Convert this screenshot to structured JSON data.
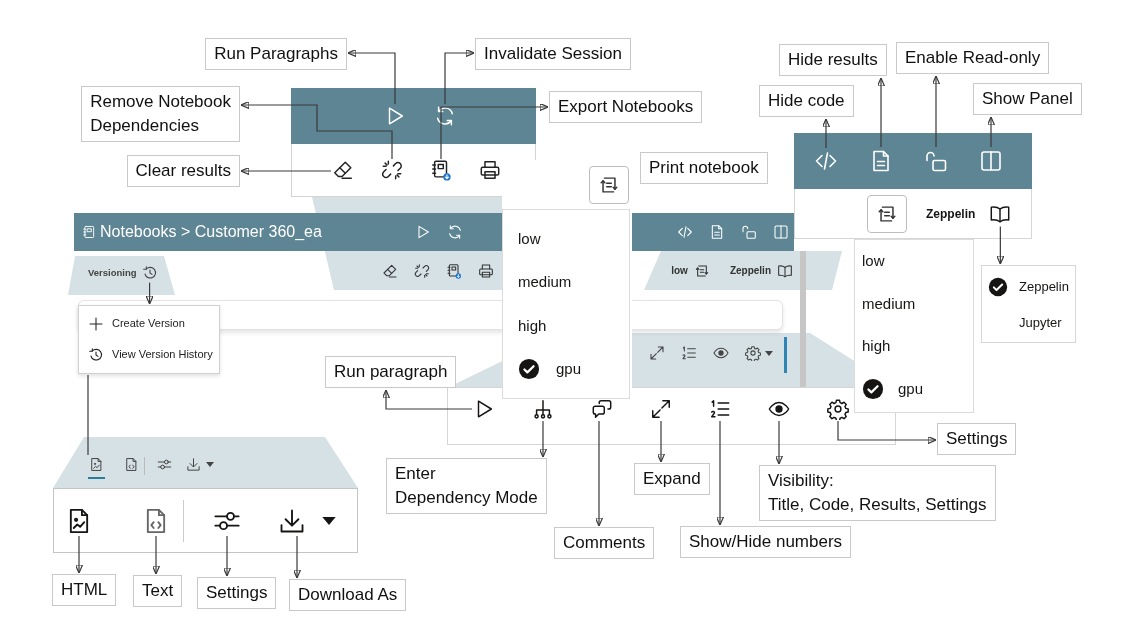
{
  "callouts": [
    {
      "lines": [
        "Run Paragraphs"
      ]
    },
    {
      "lines": [
        "Invalidate Session"
      ]
    },
    {
      "lines": [
        "Remove Notebook",
        "Dependencies"
      ]
    },
    {
      "lines": [
        "Export Notebooks"
      ]
    },
    {
      "lines": [
        "Clear results"
      ]
    },
    {
      "lines": [
        "Print notebook"
      ]
    },
    {
      "lines": [
        "Hide results"
      ]
    },
    {
      "lines": [
        "Enable Read-only"
      ]
    },
    {
      "lines": [
        "Hide code"
      ]
    },
    {
      "lines": [
        "Show Panel"
      ]
    },
    {
      "lines": [
        "Run paragraph"
      ]
    },
    {
      "lines": [
        "Settings"
      ]
    },
    {
      "lines": [
        "Enter",
        "Dependency Mode"
      ]
    },
    {
      "lines": [
        "Expand"
      ]
    },
    {
      "lines": [
        "Visibility:",
        "Title, Code, Results, Settings"
      ]
    },
    {
      "lines": [
        "Comments"
      ]
    },
    {
      "lines": [
        "Show/Hide numbers"
      ]
    },
    {
      "lines": [
        "HTML"
      ]
    },
    {
      "lines": [
        "Text"
      ]
    },
    {
      "lines": [
        "Settings"
      ]
    },
    {
      "lines": [
        "Download As"
      ]
    }
  ],
  "compute_popup": {
    "items": [
      {
        "label": "low",
        "selected": false
      },
      {
        "label": "medium",
        "selected": false
      },
      {
        "label": "high",
        "selected": false
      },
      {
        "label": "gpu",
        "selected": true
      }
    ]
  },
  "notebook_strip": {
    "title": "Notebooks > Customer 360_ea",
    "versioning": "Versioning",
    "compute": "low",
    "interpreter": "Zeppelin"
  },
  "right_panel": {
    "interpreter": "Zeppelin",
    "compute_menu": [
      {
        "label": "low",
        "selected": false
      },
      {
        "label": "medium",
        "selected": false
      },
      {
        "label": "high",
        "selected": false
      },
      {
        "label": "gpu",
        "selected": true
      }
    ],
    "interpreter_menu": [
      {
        "label": "Zeppelin",
        "selected": true
      },
      {
        "label": "Jupyter",
        "selected": false
      }
    ]
  },
  "versioning_menu": [
    {
      "label": "Create Version"
    },
    {
      "label": "View Version History"
    }
  ],
  "download_panel": {
    "tabs": [
      {
        "selected": true
      },
      {
        "selected": false
      }
    ]
  }
}
